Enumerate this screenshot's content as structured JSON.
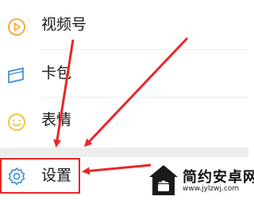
{
  "menu": {
    "items": [
      {
        "label": "视频号",
        "icon": "channels-icon"
      },
      {
        "label": "卡包",
        "icon": "card-wallet-icon"
      },
      {
        "label": "表情",
        "icon": "smiley-icon"
      },
      {
        "label": "设置",
        "icon": "gear-icon"
      }
    ]
  },
  "colors": {
    "channels_icon": "#f0a830",
    "card_icon": "#3a8fd6",
    "sticker_icon": "#f2c230",
    "settings_icon": "#3a8fd6",
    "annotation": "#e8262a",
    "section_gap": "#ededed"
  },
  "watermark": {
    "title": "简约安卓网",
    "url": "www.jylzwj.com"
  }
}
